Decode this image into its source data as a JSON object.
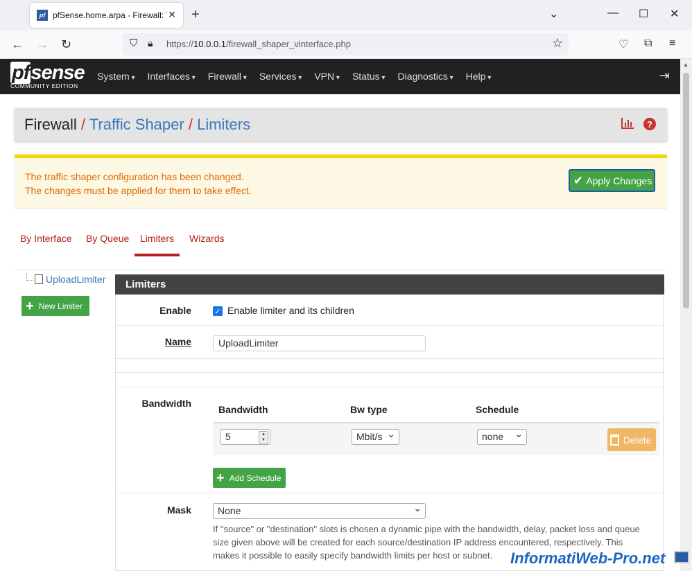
{
  "browser": {
    "tab_title": "pfSense.home.arpa - Firewall: Tr",
    "favicon_text": "pf",
    "url_protocol": "https://",
    "url_host": "10.0.0.1",
    "url_path": "/firewall_shaper_vinterface.php"
  },
  "header": {
    "logo_prefix": "pf",
    "logo_main": "sense",
    "logo_sub": "COMMUNITY EDITION",
    "menu": [
      "System",
      "Interfaces",
      "Firewall",
      "Services",
      "VPN",
      "Status",
      "Diagnostics",
      "Help"
    ]
  },
  "breadcrumb": {
    "root": "Firewall",
    "level2": "Traffic Shaper",
    "level3": "Limiters",
    "sep": "/"
  },
  "alert": {
    "line1": "The traffic shaper configuration has been changed.",
    "line2": "The changes must be applied for them to take effect.",
    "apply_label": "Apply Changes"
  },
  "tabs": [
    "By Interface",
    "By Queue",
    "Limiters",
    "Wizards"
  ],
  "active_tab": "Limiters",
  "tree": {
    "item": "UploadLimiter",
    "new_button": "New Limiter"
  },
  "panel": {
    "title": "Limiters",
    "enable_label": "Enable",
    "enable_text": "Enable limiter and its children",
    "name_label": "Name",
    "name_value": "UploadLimiter",
    "bandwidth_label": "Bandwidth",
    "col_bandwidth": "Bandwidth",
    "col_bwtype": "Bw type",
    "col_schedule": "Schedule",
    "bandwidth_value": "5",
    "bwtype_value": "Mbit/s",
    "schedule_value": "none",
    "delete_label": "Delete",
    "add_schedule_label": "Add Schedule",
    "mask_label": "Mask",
    "mask_value": "None",
    "mask_help": "If \"source\" or \"destination\" slots is chosen a dynamic pipe with the bandwidth, delay, packet loss and queue size given above will be created for each source/destination IP address encountered, respectively. This makes it possible to easily specify bandwidth limits per host or subnet."
  },
  "watermark": "InformatiWeb-Pro.net"
}
